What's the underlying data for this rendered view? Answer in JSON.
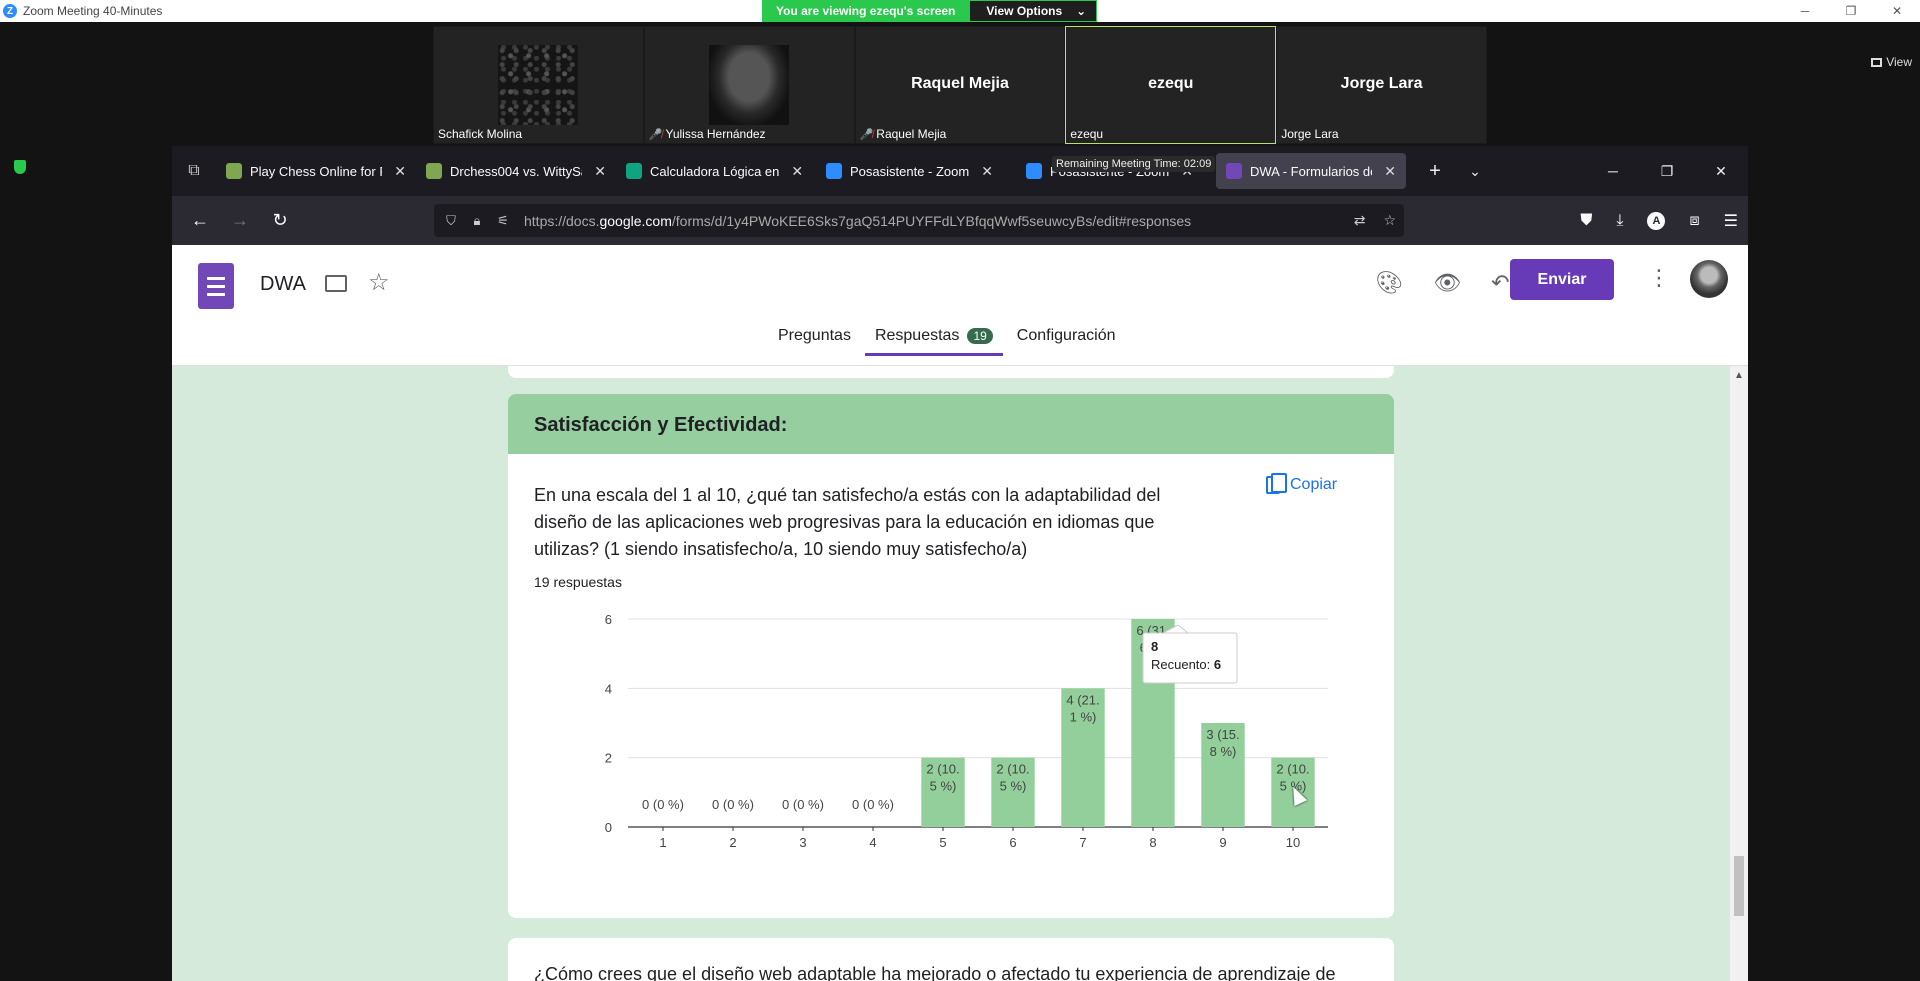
{
  "zoom": {
    "window_title": "Zoom Meeting 40-Minutes",
    "share_banner": "You are viewing ezequ's screen",
    "view_options": "View Options",
    "view_button": "View",
    "participants": [
      {
        "name": "Schafick Molina",
        "center": "",
        "muted": false,
        "photo": "texture"
      },
      {
        "name": "Yulissa Hernández",
        "center": "",
        "muted": true,
        "photo": "helmet"
      },
      {
        "name": "Raquel Mejia",
        "center": "Raquel Mejia",
        "muted": true,
        "photo": ""
      },
      {
        "name": "ezequ",
        "center": "ezequ",
        "muted": false,
        "photo": ""
      },
      {
        "name": "Jorge Lara",
        "center": "Jorge Lara",
        "muted": false,
        "photo": ""
      }
    ]
  },
  "browser": {
    "tabs": [
      {
        "label": "Play Chess Online for F",
        "icon": "chess-pawn-icon",
        "color": "#7fa650"
      },
      {
        "label": "Drchess004 vs. WittySa",
        "icon": "chess-pawn-icon",
        "color": "#7fa650"
      },
      {
        "label": "Calculadora Lógica en",
        "icon": "openai-icon",
        "color": "#10a37f"
      },
      {
        "label": "Posasistente - Zoom",
        "icon": "zoom-icon",
        "color": "#2d8cff"
      },
      {
        "label": "Posasistente - Zoom",
        "icon": "zoom-icon",
        "color": "#2d8cff"
      },
      {
        "label": "DWA - Formularios de",
        "icon": "google-forms-icon",
        "color": "#7248b9"
      }
    ],
    "meeting_timer": "Remaining Meeting Time: 02:09",
    "url_prefix": "https://docs.",
    "url_host": "google.com",
    "url_rest": "/forms/d/1y4PWoKEE6Sks7gaQ514PUYFFdLYBfqqWwf5seuwcyBs/edit#responses"
  },
  "forms": {
    "title": "DWA",
    "send_label": "Enviar",
    "tabs": {
      "questions": "Preguntas",
      "responses": "Respuestas",
      "responses_count": "19",
      "settings": "Configuración"
    },
    "section_title": "Satisfacción y Efectividad:",
    "question": "En una escala del 1 al 10, ¿qué tan satisfecho/a estás con la adaptabilidad del diseño de las aplicaciones web progresivas para la educación en idiomas que utilizas? (1 siendo insatisfecho/a, 10 siendo muy satisfecho/a)",
    "responses_label": "19 respuestas",
    "copy_label": "Copiar",
    "next_question": "¿Cómo crees que el diseño web adaptable ha mejorado o afectado tu experiencia de aprendizaje de"
  },
  "chart_data": {
    "type": "bar",
    "categories": [
      "1",
      "2",
      "3",
      "4",
      "5",
      "6",
      "7",
      "8",
      "9",
      "10"
    ],
    "values": [
      0,
      0,
      0,
      0,
      2,
      2,
      4,
      6,
      3,
      2
    ],
    "data_labels": [
      [
        "0 (0 %)"
      ],
      [
        "0 (0 %)"
      ],
      [
        "0 (0 %)"
      ],
      [
        "0 (0 %)"
      ],
      [
        "2 (10.",
        "5 %)"
      ],
      [
        "2 (10.",
        "5 %)"
      ],
      [
        "4 (21.",
        "1 %)"
      ],
      [
        "6 (31.",
        "6 %)"
      ],
      [
        "3 (15.",
        "8 %)"
      ],
      [
        "2 (10.",
        "5 %)"
      ]
    ],
    "yticks": [
      "0",
      "2",
      "4",
      "6"
    ],
    "ylim": [
      0,
      6
    ],
    "bar_color": "#93cf9b",
    "tooltip": {
      "category": "8",
      "label": "Recuento:",
      "value": "6"
    }
  }
}
